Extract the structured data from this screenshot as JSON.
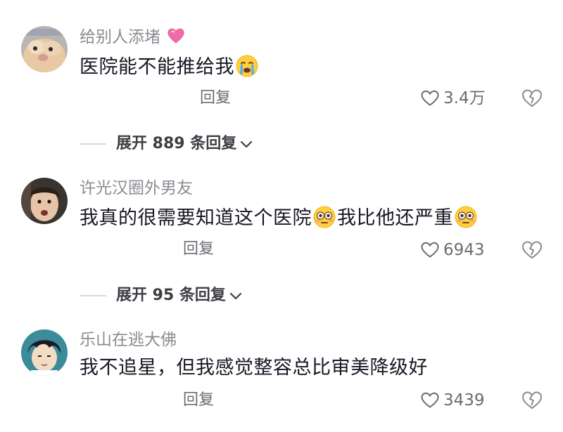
{
  "comments": [
    {
      "username": "给别人添堵",
      "text": "医院能不能推给我",
      "reply_label": "回复",
      "likes": "3.4万",
      "expand_label": "展开 889 条回复"
    },
    {
      "username": "许光汉圈外男友",
      "text_part1": "我真的很需要知道这个医院",
      "text_part2": "我比他还严重",
      "reply_label": "回复",
      "likes": "6943",
      "expand_label": "展开 95 条回复"
    },
    {
      "username": "乐山在逃大佛",
      "text": "我不追星，但我感觉整容总比审美降级好",
      "reply_label": "回复",
      "likes": "3439"
    }
  ],
  "icons": {
    "name_badge": "pink-heart-icon",
    "emoji_1": "crying-face-emoji",
    "emoji_2": "flushed-face-emoji",
    "like": "heart-outline-icon",
    "dislike": "broken-heart-icon",
    "expand": "chevron-down-icon"
  },
  "colors": {
    "text": "#161823",
    "secondary": "#8a8b91",
    "muted": "#6b6c72"
  }
}
